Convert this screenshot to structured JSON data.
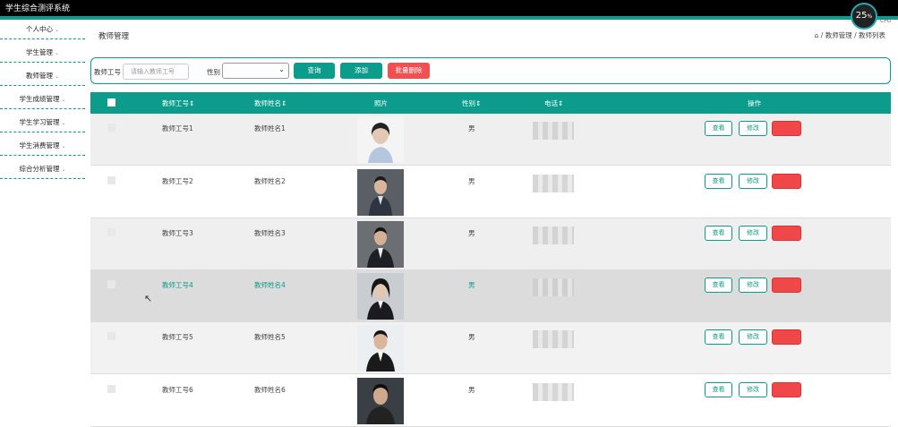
{
  "app": {
    "title": "学生综合测评系统",
    "cpu_value": "25",
    "cpu_unit": "%",
    "cpu_label": "CPU"
  },
  "colors": {
    "accent": "#0c9c8c",
    "danger": "#f05050"
  },
  "sidebar": {
    "items": [
      {
        "label": "个人中心"
      },
      {
        "label": "学生管理"
      },
      {
        "label": "教师管理"
      },
      {
        "label": "学生成绩管理"
      },
      {
        "label": "学生学习管理"
      },
      {
        "label": "学生消费管理"
      },
      {
        "label": "综合分析管理"
      }
    ]
  },
  "header": {
    "title": "教师管理",
    "breadcrumb": "/ 教师管理 / 教师列表"
  },
  "search": {
    "id_label": "教师工号",
    "id_placeholder": "请输入教师工号",
    "gender_label": "性别",
    "gender_value": "",
    "query_button": "查询",
    "add_button": "添加",
    "bulk_delete_button": "批量删除"
  },
  "table": {
    "columns": [
      "教师工号",
      "教师姓名",
      "照片",
      "性别",
      "电话",
      "操作"
    ],
    "sort_icon": "⇕",
    "actions": {
      "view": "查看",
      "edit": "修改",
      "delete": "删除"
    },
    "rows": [
      {
        "id": "教师工号1",
        "name": "教师姓名1",
        "gender": "男",
        "photo": "female-light"
      },
      {
        "id": "教师工号2",
        "name": "教师姓名2",
        "gender": "男",
        "photo": "male-gray"
      },
      {
        "id": "教师工号3",
        "name": "教师姓名3",
        "gender": "男",
        "photo": "male-gray"
      },
      {
        "id": "教师工号4",
        "name": "教师姓名4",
        "gender": "男",
        "photo": "female-dark"
      },
      {
        "id": "教师工号5",
        "name": "教师姓名5",
        "gender": "男",
        "photo": "male-dark"
      },
      {
        "id": "教师工号6",
        "name": "教师姓名6",
        "gender": "男",
        "photo": "male-dark"
      }
    ]
  }
}
